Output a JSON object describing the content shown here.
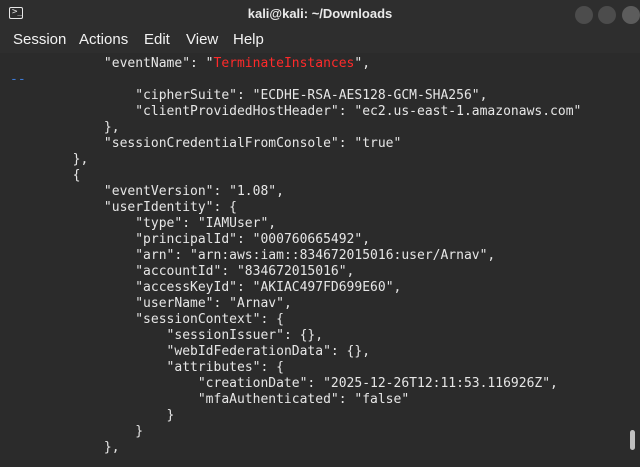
{
  "window": {
    "title": "kali@kali: ~/Downloads"
  },
  "menu": [
    "Session",
    "Actions",
    "Edit",
    "View",
    "Help"
  ],
  "terminal": {
    "lines": [
      {
        "indent": "            ",
        "pre": "\"eventName\": \"",
        "hl": "TerminateInstances",
        "post": "\","
      },
      {
        "indent": "",
        "pre": "--",
        "hl": "",
        "post": ""
      },
      {
        "indent": "                ",
        "pre": "\"cipherSuite\": \"ECDHE-RSA-AES128-GCM-SHA256\",",
        "hl": "",
        "post": ""
      },
      {
        "indent": "                ",
        "pre": "\"clientProvidedHostHeader\": \"ec2.us-east-1.amazonaws.com\"",
        "hl": "",
        "post": ""
      },
      {
        "indent": "            ",
        "pre": "},",
        "hl": "",
        "post": ""
      },
      {
        "indent": "            ",
        "pre": "\"sessionCredentialFromConsole\": \"true\"",
        "hl": "",
        "post": ""
      },
      {
        "indent": "        ",
        "pre": "},",
        "hl": "",
        "post": ""
      },
      {
        "indent": "        ",
        "pre": "{",
        "hl": "",
        "post": ""
      },
      {
        "indent": "            ",
        "pre": "\"eventVersion\": \"1.08\",",
        "hl": "",
        "post": ""
      },
      {
        "indent": "            ",
        "pre": "\"userIdentity\": {",
        "hl": "",
        "post": ""
      },
      {
        "indent": "                ",
        "pre": "\"type\": \"IAMUser\",",
        "hl": "",
        "post": ""
      },
      {
        "indent": "                ",
        "pre": "\"principalId\": \"000760665492\",",
        "hl": "",
        "post": ""
      },
      {
        "indent": "                ",
        "pre": "\"arn\": \"arn:aws:iam::834672015016:user/Arnav\",",
        "hl": "",
        "post": ""
      },
      {
        "indent": "                ",
        "pre": "\"accountId\": \"834672015016\",",
        "hl": "",
        "post": ""
      },
      {
        "indent": "                ",
        "pre": "\"accessKeyId\": \"AKIAC497FD699E60\",",
        "hl": "",
        "post": ""
      },
      {
        "indent": "                ",
        "pre": "\"userName\": \"Arnav\",",
        "hl": "",
        "post": ""
      },
      {
        "indent": "                ",
        "pre": "\"sessionContext\": {",
        "hl": "",
        "post": ""
      },
      {
        "indent": "                    ",
        "pre": "\"sessionIssuer\": {},",
        "hl": "",
        "post": ""
      },
      {
        "indent": "                    ",
        "pre": "\"webIdFederationData\": {},",
        "hl": "",
        "post": ""
      },
      {
        "indent": "                    ",
        "pre": "\"attributes\": {",
        "hl": "",
        "post": ""
      },
      {
        "indent": "                        ",
        "pre": "\"creationDate\": \"2025-12-26T12:11:53.116926Z\",",
        "hl": "",
        "post": ""
      },
      {
        "indent": "                        ",
        "pre": "\"mfaAuthenticated\": \"false\"",
        "hl": "",
        "post": ""
      },
      {
        "indent": "                    ",
        "pre": "}",
        "hl": "",
        "post": ""
      },
      {
        "indent": "                ",
        "pre": "}",
        "hl": "",
        "post": ""
      },
      {
        "indent": "            ",
        "pre": "},",
        "hl": "",
        "post": ""
      }
    ]
  },
  "colors": {
    "background": "#2b2b2b",
    "highlight": "#ff2a2a",
    "separator": "#3d7bd6"
  }
}
